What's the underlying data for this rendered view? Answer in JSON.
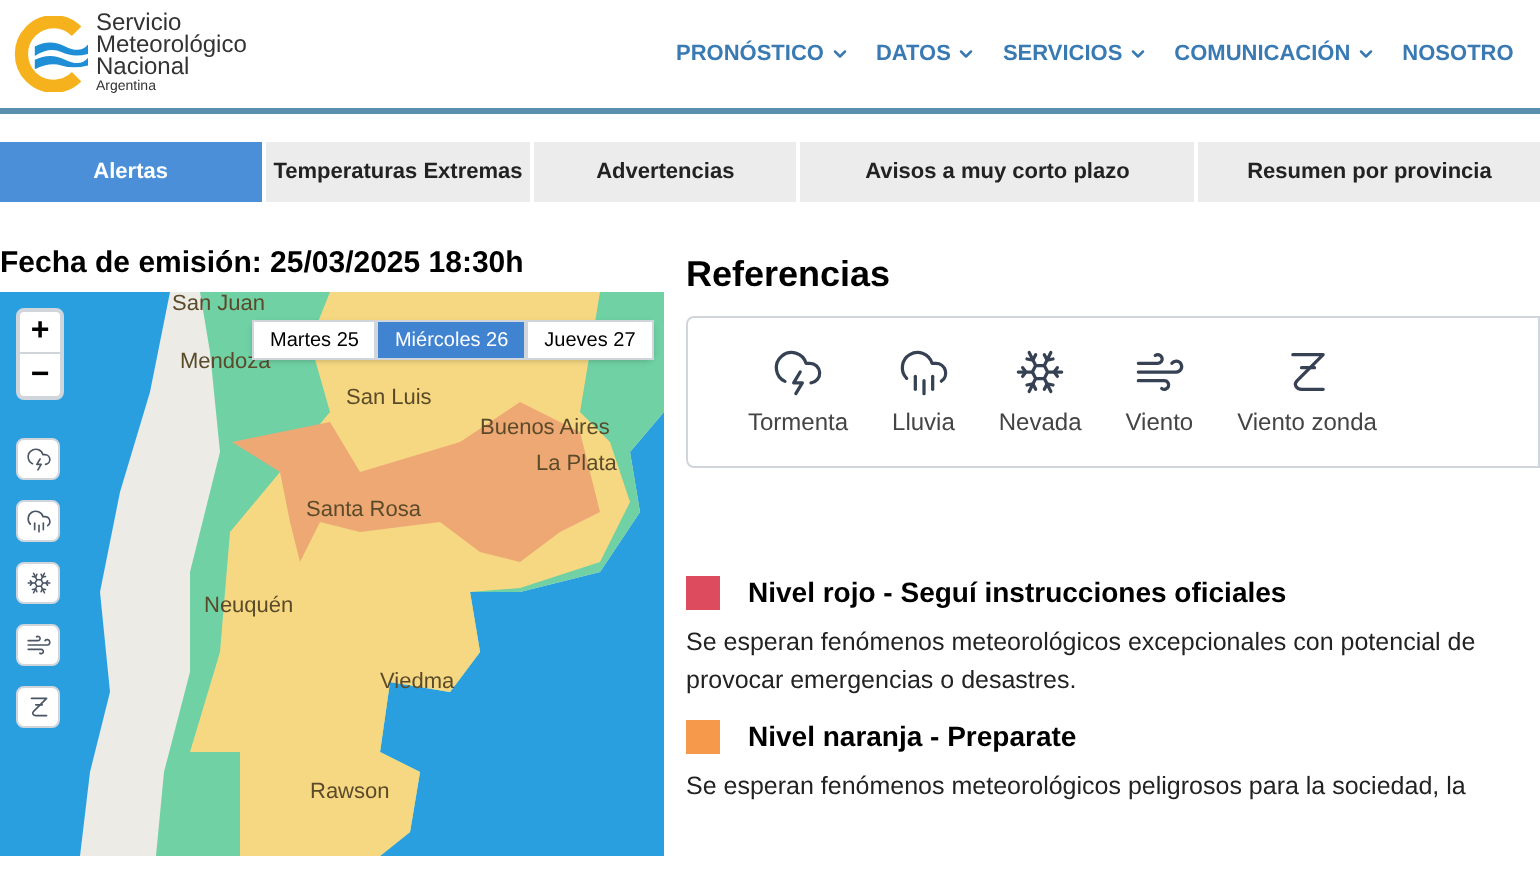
{
  "logo": {
    "lines": [
      "Servicio",
      "Meteorológico",
      "Nacional"
    ],
    "country": "Argentina"
  },
  "nav": [
    {
      "label": "PRONÓSTICO",
      "dropdown": true
    },
    {
      "label": "DATOS",
      "dropdown": true
    },
    {
      "label": "SERVICIOS",
      "dropdown": true
    },
    {
      "label": "COMUNICACIÓN",
      "dropdown": true
    },
    {
      "label": "NOSOTRO",
      "dropdown": false
    }
  ],
  "tabs": [
    {
      "label": "Alertas",
      "selected": true
    },
    {
      "label": "Temperaturas Extremas",
      "selected": false
    },
    {
      "label": "Advertencias",
      "selected": false
    },
    {
      "label": "Avisos a muy corto plazo",
      "selected": false
    },
    {
      "label": "Resumen por provincia",
      "selected": false
    }
  ],
  "issue_date": "Fecha de emisión: 25/03/2025 18:30h",
  "map": {
    "zoom_in": "+",
    "zoom_out": "−",
    "days": [
      {
        "label": "Martes 25",
        "selected": false
      },
      {
        "label": "Miércoles 26",
        "selected": true
      },
      {
        "label": "Jueves 27",
        "selected": false
      }
    ],
    "layers": [
      {
        "kind": "storm"
      },
      {
        "kind": "rain"
      },
      {
        "kind": "snow"
      },
      {
        "kind": "wind"
      },
      {
        "kind": "zonda"
      }
    ],
    "cities": [
      {
        "name": "San Juan"
      },
      {
        "name": "Mendoza"
      },
      {
        "name": "San Luis"
      },
      {
        "name": "Buenos Aires"
      },
      {
        "name": "La Plata"
      },
      {
        "name": "Santa Rosa"
      },
      {
        "name": "Neuquén"
      },
      {
        "name": "Viedma"
      },
      {
        "name": "Rawson"
      }
    ]
  },
  "references": {
    "title": "Referencias",
    "items": [
      {
        "kind": "storm",
        "label": "Tormenta"
      },
      {
        "kind": "rain",
        "label": "Lluvia"
      },
      {
        "kind": "snow",
        "label": "Nevada"
      },
      {
        "kind": "wind",
        "label": "Viento"
      },
      {
        "kind": "zonda",
        "label": "Viento zonda"
      }
    ]
  },
  "levels": [
    {
      "color": "#dd4b5f",
      "title": "Nivel rojo - Seguí instrucciones oficiales",
      "description": "Se esperan fenómenos meteorológicos excepcionales con potencial de provocar emergencias o desastres."
    },
    {
      "color": "#f7994a",
      "title": "Nivel naranja - Preparate",
      "description": "Se esperan fenómenos meteorológicos peligrosos para la sociedad, la"
    }
  ]
}
